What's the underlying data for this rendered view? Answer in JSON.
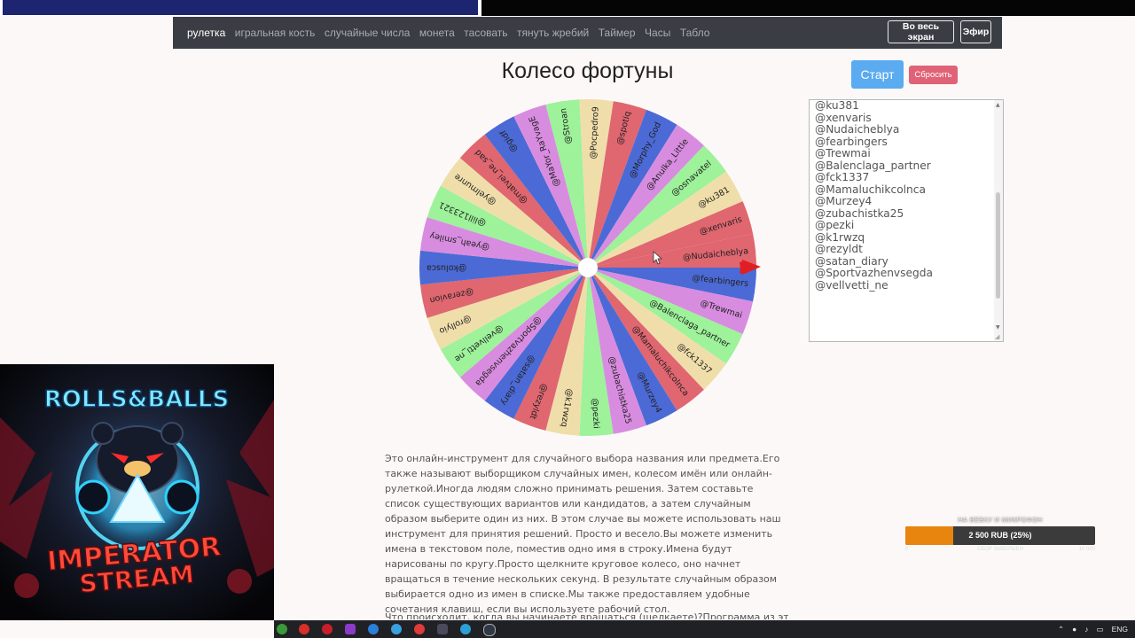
{
  "nav": {
    "items": [
      "рулетка",
      "игральная кость",
      "случайные числа",
      "монета",
      "тасовать",
      "тянуть жребий",
      "Таймер",
      "Часы",
      "Табло"
    ],
    "active_index": 0,
    "fullscreen_label": "Во весь экран",
    "air_label": "Эфир"
  },
  "page_title": "Колесо фортуны",
  "buttons": {
    "start": "Старт",
    "reset": "Сбросить"
  },
  "wheel": {
    "colors": [
      "#e06670",
      "#4b6ad6",
      "#d88ce0",
      "#9df29a",
      "#f0deaa"
    ],
    "center_color": "#ffffff",
    "pointer_color": "#e01f22",
    "segments": [
      "@Nudaicheblya",
      "@fearbingers",
      "@Trewmai",
      "@Balenclaga_partner",
      "@fck1337",
      "@Mamaluchikcolnca",
      "@Murzey4",
      "@zubachistka25",
      "@pezki",
      "@k1rwzq",
      "@rezyldt",
      "@satan_diary",
      "@Sportvazhenvsegda",
      "@vellvetti_ne",
      "@rollyio",
      "@zeravion",
      "@kolusca",
      "@yeah_smiley",
      "@lill123321",
      "@yelmunre",
      "@matvei_ne_sad",
      "@gidf",
      "@MaYor_RaYvagE",
      "@Stroan",
      "@Pocpedro9",
      "@spotiq",
      "@Morphy_God",
      "@Anulka_Little",
      "@osnavatel",
      "@ku381",
      "@xenvaris"
    ]
  },
  "names_list": [
    "@ku381",
    "@xenvaris",
    "@Nudaicheblya",
    "@fearbingers",
    "@Trewmai",
    "@Balenclaga_partner",
    "@fck1337",
    "@Mamaluchikcolnca",
    "@Murzey4",
    "@zubachistka25",
    "@pezki",
    "@k1rwzq",
    "@rezyldt",
    "@satan_diary",
    "@Sportvazhenvsegda",
    "@vellvetti_ne"
  ],
  "description": "Это онлайн-инструмент для случайного выбора названия или предмета.Его также называют выборщиком случайных имен, колесом имён или онлайн-рулеткой.Иногда людям сложно принимать решения. Затем составьте список существующих вариантов или кандидатов, а затем случайным образом выберите один из них. В этом случае вы можете использовать наш инструмент для принятия решений. Просто и весело.Вы можете изменить имена в текстовом поле, поместив одно имя в строку.Имена будут нарисованы по кругу.Просто щелкните круговое колесо, оно начнет вращаться в течение нескольких секунд. В результате случайным образом выбирается одно из имен в списке.Мы также предоставляем удобные сочетания клавиш, если вы используете рабочий стол.",
  "description2": "Что происходит, когда вы начинаете вращаться (щелкаете)?Программа из этой",
  "overlay": {
    "logo_top": "ROLLS&BALLS",
    "logo_bottom_1": "IMPERATOR",
    "logo_bottom_2": "STREAM"
  },
  "donation": {
    "title": "НА ВЕБКУ И МИКРОФОН",
    "amount_text": "2 500 RUB (25%)",
    "progress": 0.25,
    "min": "0",
    "caption": "СБОР ЗАВЕРШЕН",
    "max": "10 000"
  },
  "taskbar": {
    "icons": [
      "chrome-icon",
      "yandex-icon",
      "opera-icon",
      "media-icon",
      "telegram-icon",
      "drive-icon",
      "yandex-browser-icon",
      "obs-icon",
      "telegram-icon",
      "steam-icon"
    ],
    "tray_lang": "ENG"
  }
}
